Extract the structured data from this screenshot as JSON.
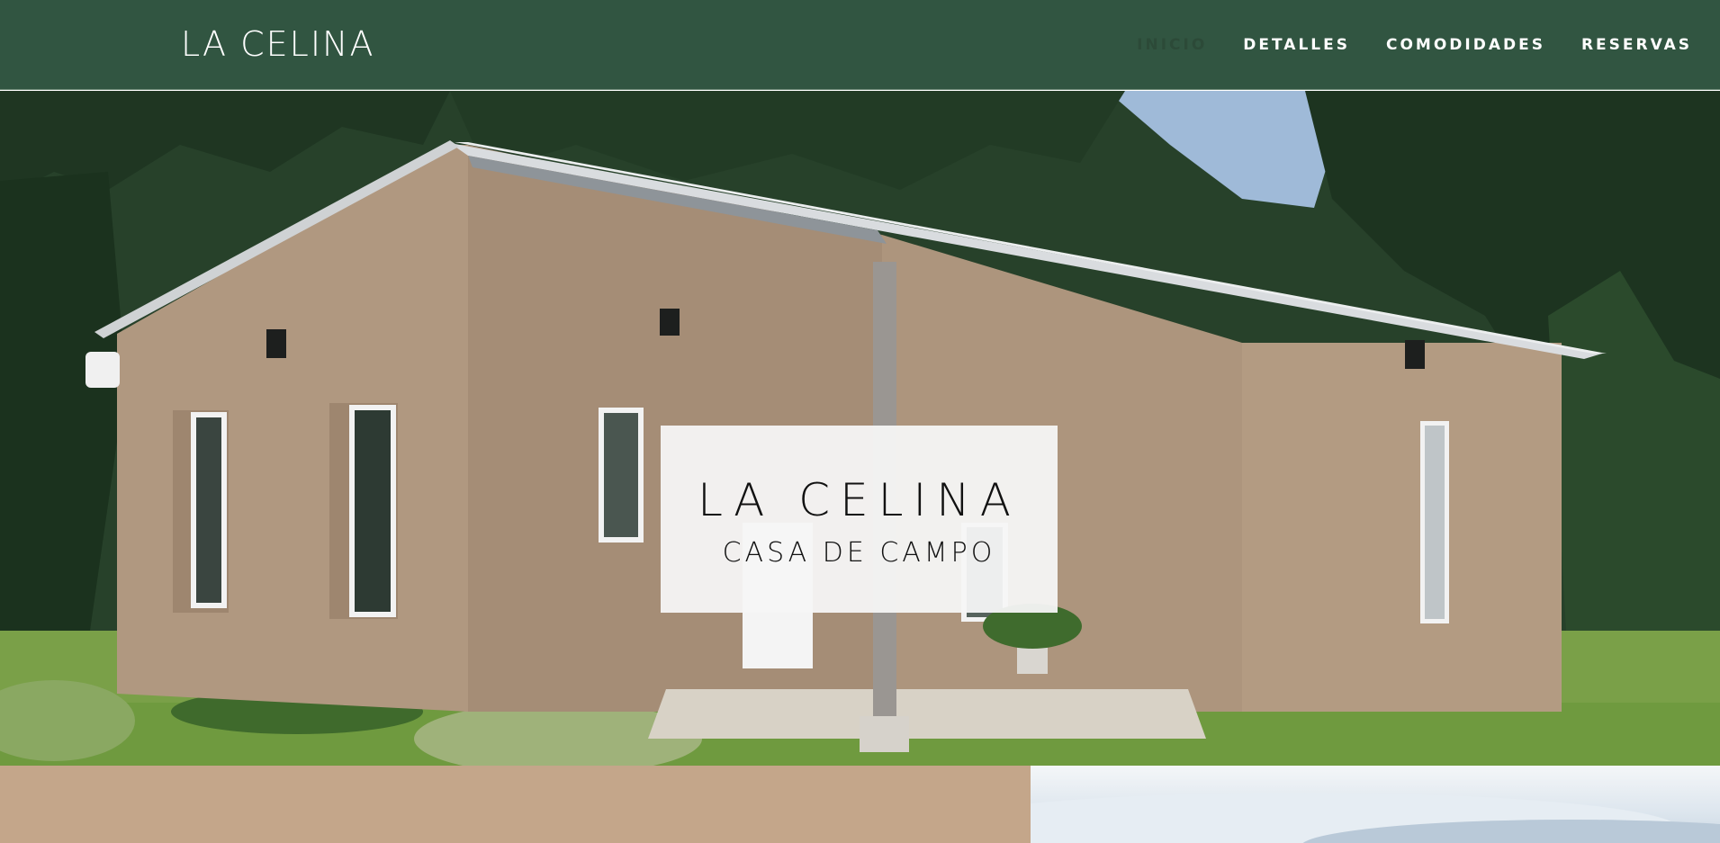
{
  "header": {
    "brand": "LA CELINA",
    "nav": [
      {
        "label": "INICIO",
        "active": true
      },
      {
        "label": "DETALLES",
        "active": false
      },
      {
        "label": "COMODIDADES",
        "active": false
      },
      {
        "label": "RESERVAS",
        "active": false
      }
    ]
  },
  "hero": {
    "title": "LA CELINA",
    "subtitle": "CASA DE CAMPO"
  },
  "colors": {
    "header_bg": "#315541",
    "accent_tan": "#c4a68a",
    "house_wall": "#b39b82"
  }
}
